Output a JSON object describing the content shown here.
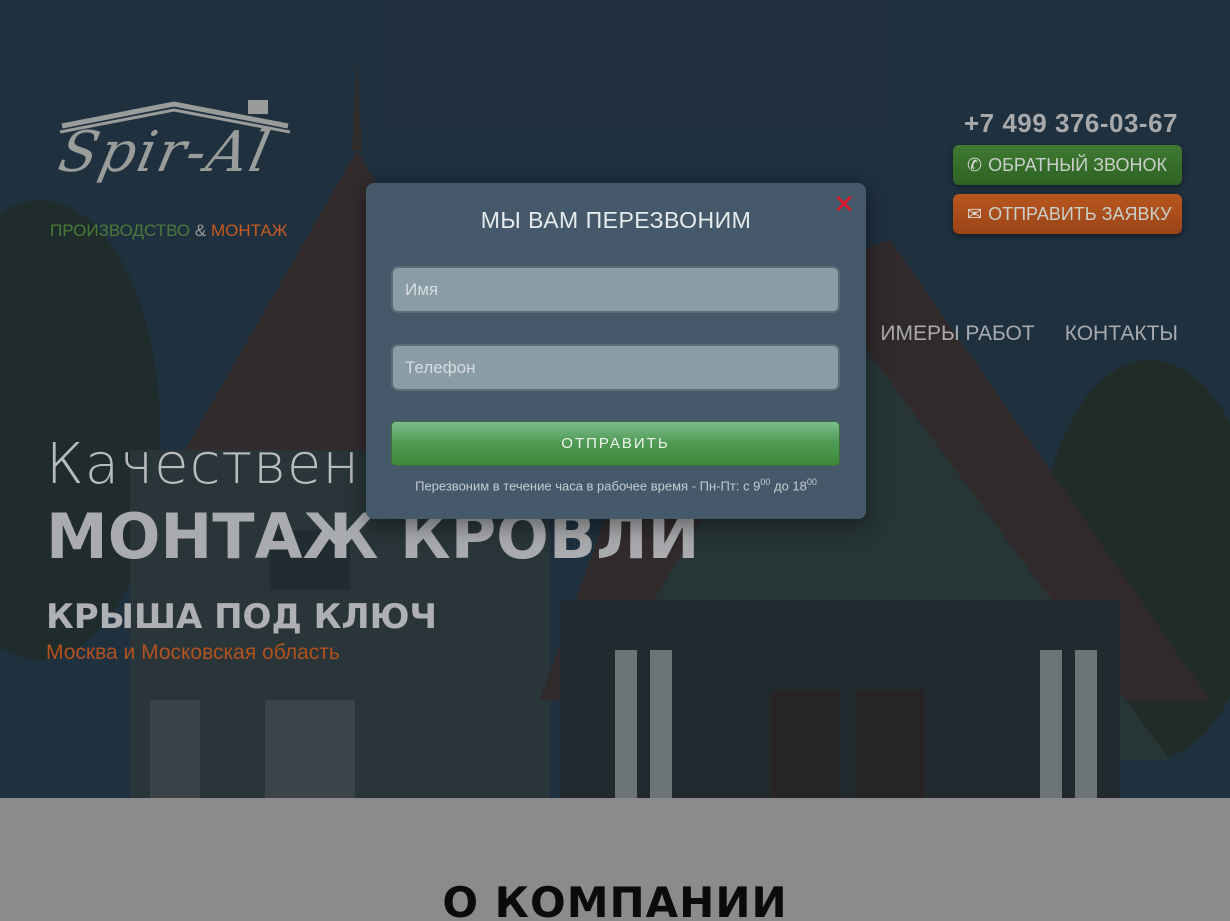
{
  "logo": {
    "script": "Spir-Al",
    "sub_production": "ПРОИЗВОДСТВО",
    "sub_amp": " & ",
    "sub_mount": "МОНТАЖ"
  },
  "header": {
    "phone": "+7 499 376-03-67",
    "callback_label": "ОБРАТНЫЙ ЗВОНОК",
    "request_label": "ОТПРАВИТЬ ЗАЯВКУ"
  },
  "nav": {
    "items": [
      {
        "label": "ИМЕРЫ РАБОТ"
      },
      {
        "label": "КОНТАКТЫ"
      }
    ]
  },
  "hero": {
    "line1": "Качествен",
    "line2": "МОНТАЖ КРОВЛИ",
    "line3": "КРЫША ПОД КЛЮЧ",
    "region": "Москва и Московская область"
  },
  "modal": {
    "title": "МЫ ВАМ ПЕРЕЗВОНИМ",
    "close_glyph": "✕",
    "name_placeholder": "Имя",
    "phone_placeholder": "Телефон",
    "submit_label": "ОТПРАВИТЬ",
    "note_text": "Перезвоним в течение часа в рабочее время - Пн-Пт: с 9",
    "note_sup1": "00",
    "note_mid": " до 18",
    "note_sup2": "00"
  },
  "about": {
    "title": "О КОМПАНИИ"
  },
  "colors": {
    "accent_green": "#3f7a32",
    "accent_orange": "#b8571f",
    "modal_bg": "#46596a",
    "close_red": "#e0192a"
  },
  "icons": {
    "callback": "phone-icon",
    "request": "envelope-icon",
    "close": "close-icon"
  }
}
